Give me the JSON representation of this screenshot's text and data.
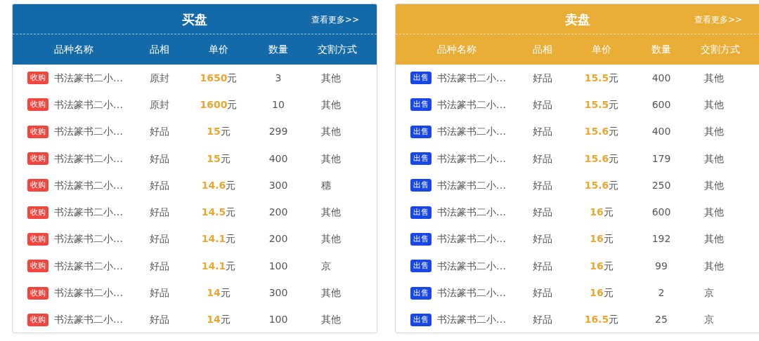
{
  "panels": [
    {
      "kind": "buy",
      "title": "买盘",
      "more_link": "查看更多>>",
      "columns": [
        "品种名称",
        "品相",
        "单价",
        "数量",
        "交割方式"
      ],
      "rows": [
        {
          "badge": "收购",
          "name": "书法篆书二小…",
          "grade": "原封",
          "price": "1650",
          "unit": "元",
          "quantity": "3",
          "delivery": "其他"
        },
        {
          "badge": "收购",
          "name": "书法篆书二小…",
          "grade": "原封",
          "price": "1600",
          "unit": "元",
          "quantity": "10",
          "delivery": "其他"
        },
        {
          "badge": "收购",
          "name": "书法篆书二小…",
          "grade": "好品",
          "price": "15",
          "unit": "元",
          "quantity": "299",
          "delivery": "其他"
        },
        {
          "badge": "收购",
          "name": "书法篆书二小…",
          "grade": "好品",
          "price": "15",
          "unit": "元",
          "quantity": "400",
          "delivery": "其他"
        },
        {
          "badge": "收购",
          "name": "书法篆书二小…",
          "grade": "好品",
          "price": "14.6",
          "unit": "元",
          "quantity": "300",
          "delivery": "穗"
        },
        {
          "badge": "收购",
          "name": "书法篆书二小…",
          "grade": "好品",
          "price": "14.5",
          "unit": "元",
          "quantity": "200",
          "delivery": "其他"
        },
        {
          "badge": "收购",
          "name": "书法篆书二小…",
          "grade": "好品",
          "price": "14.1",
          "unit": "元",
          "quantity": "200",
          "delivery": "其他"
        },
        {
          "badge": "收购",
          "name": "书法篆书二小…",
          "grade": "好品",
          "price": "14.1",
          "unit": "元",
          "quantity": "100",
          "delivery": "京"
        },
        {
          "badge": "收购",
          "name": "书法篆书二小…",
          "grade": "好品",
          "price": "14",
          "unit": "元",
          "quantity": "300",
          "delivery": "其他"
        },
        {
          "badge": "收购",
          "name": "书法篆书二小…",
          "grade": "好品",
          "price": "14",
          "unit": "元",
          "quantity": "100",
          "delivery": "其他"
        }
      ]
    },
    {
      "kind": "sell",
      "title": "卖盘",
      "more_link": "查看更多>>",
      "columns": [
        "品种名称",
        "品相",
        "单价",
        "数量",
        "交割方式"
      ],
      "rows": [
        {
          "badge": "出售",
          "name": "书法篆书二小…",
          "grade": "好品",
          "price": "15.5",
          "unit": "元",
          "quantity": "400",
          "delivery": "其他"
        },
        {
          "badge": "出售",
          "name": "书法篆书二小…",
          "grade": "好品",
          "price": "15.5",
          "unit": "元",
          "quantity": "600",
          "delivery": "其他"
        },
        {
          "badge": "出售",
          "name": "书法篆书二小…",
          "grade": "好品",
          "price": "15.6",
          "unit": "元",
          "quantity": "400",
          "delivery": "其他"
        },
        {
          "badge": "出售",
          "name": "书法篆书二小…",
          "grade": "好品",
          "price": "15.6",
          "unit": "元",
          "quantity": "179",
          "delivery": "其他"
        },
        {
          "badge": "出售",
          "name": "书法篆书二小…",
          "grade": "好品",
          "price": "15.6",
          "unit": "元",
          "quantity": "250",
          "delivery": "其他"
        },
        {
          "badge": "出售",
          "name": "书法篆书二小…",
          "grade": "好品",
          "price": "16",
          "unit": "元",
          "quantity": "600",
          "delivery": "其他"
        },
        {
          "badge": "出售",
          "name": "书法篆书二小…",
          "grade": "好品",
          "price": "16",
          "unit": "元",
          "quantity": "192",
          "delivery": "其他"
        },
        {
          "badge": "出售",
          "name": "书法篆书二小…",
          "grade": "好品",
          "price": "16",
          "unit": "元",
          "quantity": "99",
          "delivery": "其他"
        },
        {
          "badge": "出售",
          "name": "书法篆书二小…",
          "grade": "好品",
          "price": "16",
          "unit": "元",
          "quantity": "2",
          "delivery": "京"
        },
        {
          "badge": "出售",
          "name": "书法篆书二小…",
          "grade": "好品",
          "price": "16.5",
          "unit": "元",
          "quantity": "25",
          "delivery": "京"
        }
      ]
    }
  ]
}
